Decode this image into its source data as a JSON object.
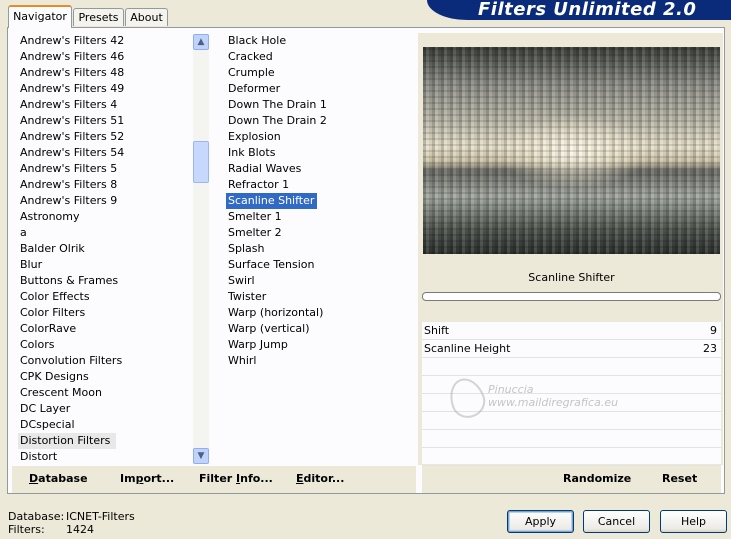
{
  "tabs": [
    {
      "label": "Navigator",
      "active": true
    },
    {
      "label": "Presets",
      "active": false
    },
    {
      "label": "About",
      "active": false
    }
  ],
  "banner_title": "Filters Unlimited 2.0",
  "categories": [
    "Andrew's Filters 42",
    "Andrew's Filters 46",
    "Andrew's Filters 48",
    "Andrew's Filters 49",
    "Andrew's Filters 4",
    "Andrew's Filters 51",
    "Andrew's Filters 52",
    "Andrew's Filters 54",
    "Andrew's Filters 5",
    "Andrew's Filters 8",
    "Andrew's Filters 9",
    "Astronomy",
    "a",
    "Balder Olrik",
    "Blur",
    "Buttons & Frames",
    "Color Effects",
    "Color Filters",
    "ColorRave",
    "Colors",
    "Convolution Filters",
    "CPK Designs",
    "Crescent Moon",
    "DC Layer",
    "DCspecial",
    "Distortion Filters",
    "Distort"
  ],
  "selected_category": "Distortion Filters",
  "filters": [
    "Black Hole",
    "Cracked",
    "Crumple",
    "Deformer",
    "Down The Drain 1",
    "Down The Drain 2",
    "Explosion",
    "Ink Blots",
    "Radial Waves",
    "Refractor 1",
    "Scanline Shifter",
    "Smelter 1",
    "Smelter 2",
    "Splash",
    "Surface Tension",
    "Swirl",
    "Twister",
    "Warp (horizontal)",
    "Warp (vertical)",
    "Warp Jump",
    "Whirl"
  ],
  "selected_filter": "Scanline Shifter",
  "preview": {
    "filter_name": "Scanline Shifter",
    "progress": 0
  },
  "params": [
    {
      "label": "Shift",
      "value": "9"
    },
    {
      "label": "Scanline Height",
      "value": "23"
    }
  ],
  "watermark": {
    "line1": "Pinuccia",
    "line2": "www.maildiregrafica.eu"
  },
  "left_buttons": {
    "database": {
      "u": "D",
      "rest": "atabase"
    },
    "import": {
      "pre": "Im",
      "u": "p",
      "rest": "ort..."
    },
    "filter_info": {
      "pre": "Filter ",
      "u": "I",
      "rest": "nfo..."
    },
    "editor": {
      "u": "E",
      "rest": "ditor..."
    }
  },
  "right_buttons": {
    "randomize": "Randomize",
    "reset": "Reset"
  },
  "footer": {
    "database_label": "Database:",
    "database_value": "ICNET-Filters",
    "filters_label": "Filters:",
    "filters_value": "1424"
  },
  "dialog_buttons": {
    "apply": "Apply",
    "cancel": "Cancel",
    "help": "Help"
  },
  "scroll_icons": {
    "up": "chevron-up-icon",
    "down": "chevron-down-icon"
  }
}
